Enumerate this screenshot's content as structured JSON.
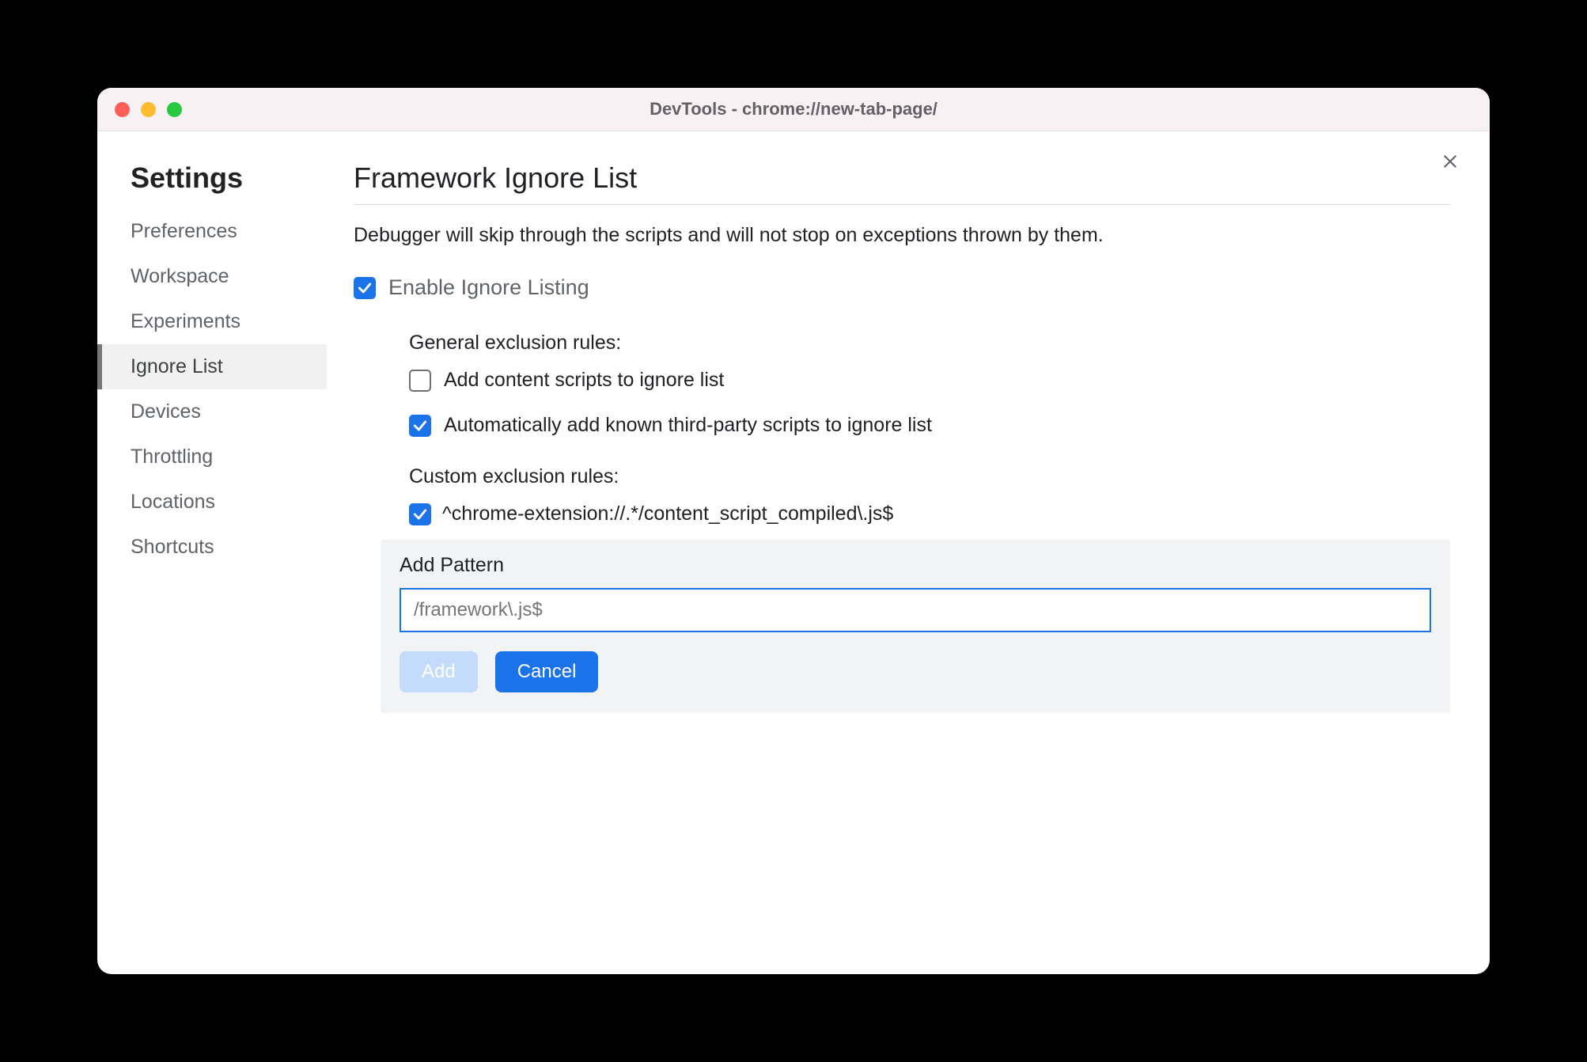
{
  "titlebar": {
    "title": "DevTools - chrome://new-tab-page/"
  },
  "sidebar": {
    "heading": "Settings",
    "items": [
      {
        "label": "Preferences",
        "active": false
      },
      {
        "label": "Workspace",
        "active": false
      },
      {
        "label": "Experiments",
        "active": false
      },
      {
        "label": "Ignore List",
        "active": true
      },
      {
        "label": "Devices",
        "active": false
      },
      {
        "label": "Throttling",
        "active": false
      },
      {
        "label": "Locations",
        "active": false
      },
      {
        "label": "Shortcuts",
        "active": false
      }
    ]
  },
  "main": {
    "title": "Framework Ignore List",
    "description": "Debugger will skip through the scripts and will not stop on exceptions thrown by them.",
    "enable": {
      "label": "Enable Ignore Listing",
      "checked": true
    },
    "general": {
      "heading": "General exclusion rules:",
      "rules": [
        {
          "label": "Add content scripts to ignore list",
          "checked": false
        },
        {
          "label": "Automatically add known third-party scripts to ignore list",
          "checked": true
        }
      ]
    },
    "custom": {
      "heading": "Custom exclusion rules:",
      "rules": [
        {
          "label": "^chrome-extension://.*/content_script_compiled\\.js$",
          "checked": true
        }
      ]
    },
    "addPanel": {
      "title": "Add Pattern",
      "placeholder": "/framework\\.js$",
      "addLabel": "Add",
      "cancelLabel": "Cancel"
    }
  }
}
